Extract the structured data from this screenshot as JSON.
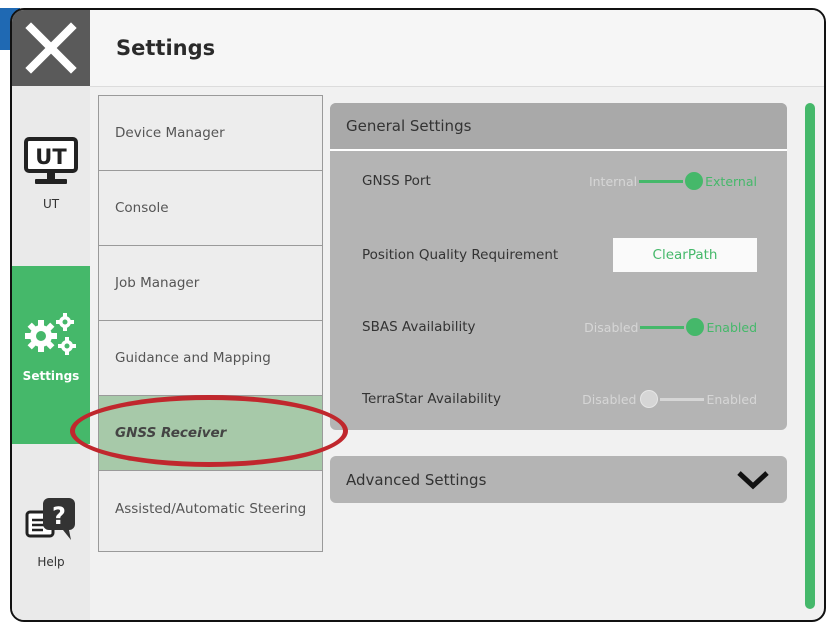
{
  "header": {
    "title": "Settings"
  },
  "rail": [
    {
      "label": "UT",
      "icon": "monitor-ut-icon",
      "screen_text": "UT"
    },
    {
      "label": "Settings",
      "icon": "gears-icon"
    },
    {
      "label": "Help",
      "icon": "help-bubble-icon"
    }
  ],
  "menu": [
    {
      "label": "Device Manager"
    },
    {
      "label": "Console"
    },
    {
      "label": "Job Manager"
    },
    {
      "label": "Guidance and Mapping"
    },
    {
      "label": "GNSS Receiver",
      "selected": true
    },
    {
      "label": "Assisted/Automatic Steering"
    }
  ],
  "general": {
    "title": "General Settings",
    "gnss_port": {
      "label": "GNSS Port",
      "off": "Internal",
      "on": "External",
      "value": "External"
    },
    "position_quality": {
      "label": "Position Quality Requirement",
      "value": "ClearPath"
    },
    "sbas": {
      "label": "SBAS Availability",
      "off": "Disabled",
      "on": "Enabled",
      "value": "Enabled"
    },
    "terrastar": {
      "label": "TerraStar Availability",
      "off": "Disabled",
      "on": "Enabled",
      "value": "Disabled"
    }
  },
  "advanced": {
    "title": "Advanced Settings",
    "icon": "chevron-down-icon"
  },
  "colors": {
    "accent": "#45b86a",
    "highlight_ring": "#c0272d",
    "brand_blue": "#1f69b3"
  }
}
